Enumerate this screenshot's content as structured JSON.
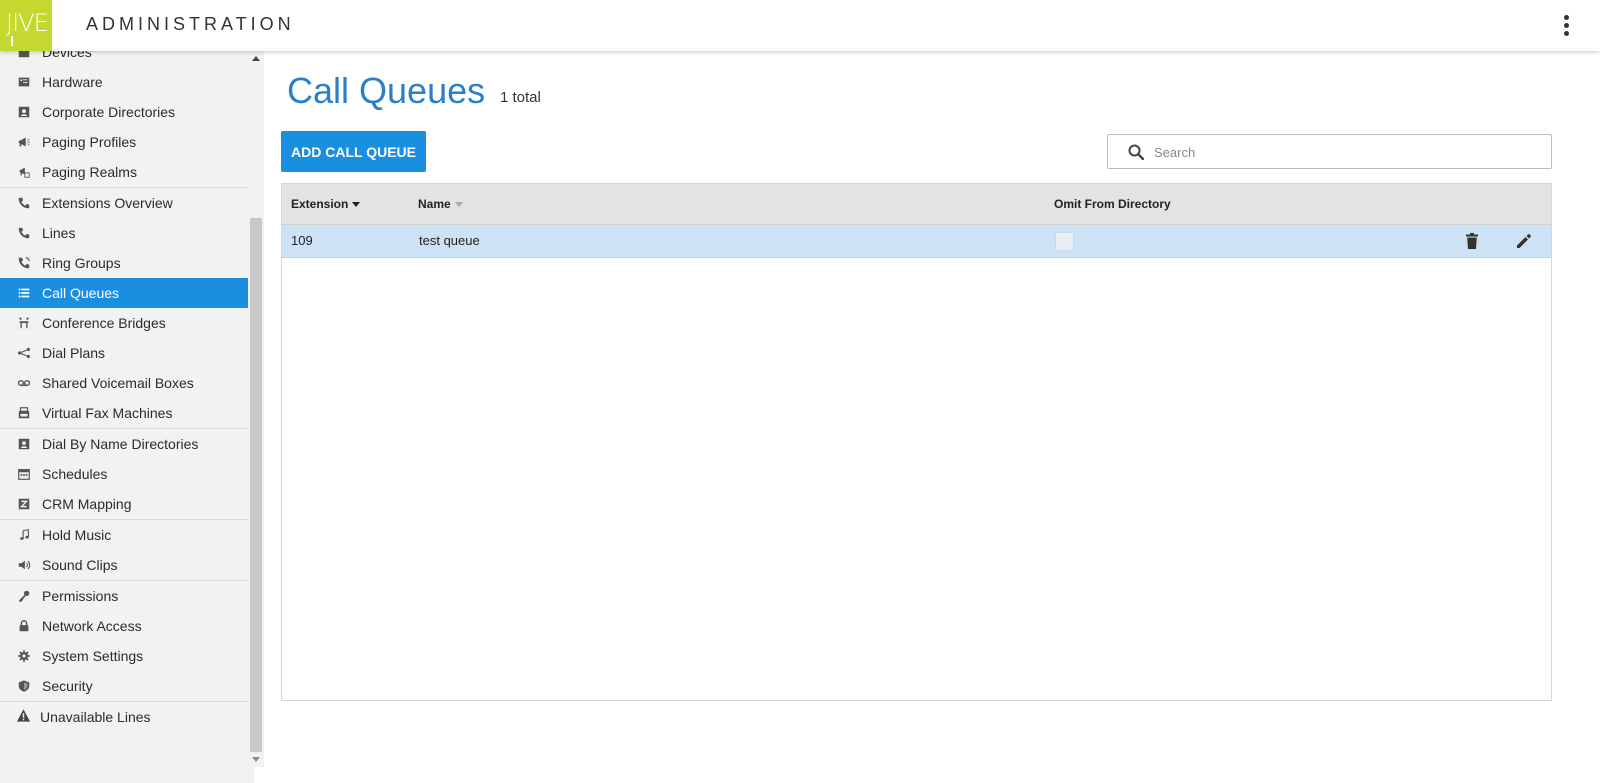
{
  "header": {
    "logo_text": "JIVE",
    "title": "ADMINISTRATION",
    "menu_icon": "kebab-menu-icon"
  },
  "sidebar": {
    "groups": [
      [
        {
          "label": "Devices",
          "icon": "devices-icon"
        },
        {
          "label": "Hardware",
          "icon": "hardware-icon"
        },
        {
          "label": "Corporate Directories",
          "icon": "contact-card-icon"
        },
        {
          "label": "Paging Profiles",
          "icon": "megaphone-icon"
        },
        {
          "label": "Paging Realms",
          "icon": "paging-realm-icon"
        }
      ],
      [
        {
          "label": "Extensions Overview",
          "icon": "phone-icon"
        },
        {
          "label": "Lines",
          "icon": "phone-icon"
        },
        {
          "label": "Ring Groups",
          "icon": "ring-group-icon"
        },
        {
          "label": "Call Queues",
          "icon": "list-icon",
          "active": true
        },
        {
          "label": "Conference Bridges",
          "icon": "conference-icon"
        },
        {
          "label": "Dial Plans",
          "icon": "share-icon"
        },
        {
          "label": "Shared Voicemail Boxes",
          "icon": "voicemail-icon"
        },
        {
          "label": "Virtual Fax Machines",
          "icon": "fax-icon"
        }
      ],
      [
        {
          "label": "Dial By Name Directories",
          "icon": "contact-card-icon"
        },
        {
          "label": "Schedules",
          "icon": "calendar-icon"
        },
        {
          "label": "CRM Mapping",
          "icon": "crm-z-icon"
        }
      ],
      [
        {
          "label": "Hold Music",
          "icon": "music-note-icon"
        },
        {
          "label": "Sound Clips",
          "icon": "speaker-icon"
        }
      ],
      [
        {
          "label": "Permissions",
          "icon": "key-icon"
        },
        {
          "label": "Network Access",
          "icon": "lock-icon"
        },
        {
          "label": "System Settings",
          "icon": "gear-icon"
        },
        {
          "label": "Security",
          "icon": "shield-icon"
        }
      ]
    ],
    "unavailable": {
      "label": "Unavailable Lines",
      "icon": "warning-icon"
    }
  },
  "main": {
    "title": "Call Queues",
    "total": "1 total",
    "add_button": "ADD CALL QUEUE",
    "search": {
      "placeholder": "Search",
      "value": ""
    },
    "table": {
      "columns": [
        "Extension",
        "Name",
        "Omit From Directory"
      ],
      "rows": [
        {
          "extension": "109",
          "name": "test queue",
          "omit": false
        }
      ]
    }
  },
  "colors": {
    "accent": "#1a8fe0",
    "title": "#2b7fc8",
    "logo": "#c5d82f",
    "row_selected": "#cde3f5"
  }
}
